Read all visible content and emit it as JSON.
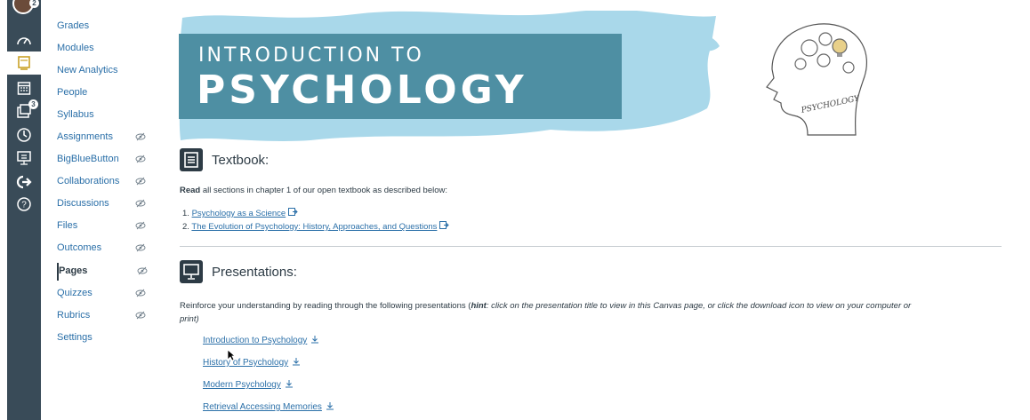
{
  "course_nav": {
    "items": [
      {
        "label": "Grades",
        "hidden": false
      },
      {
        "label": "Modules",
        "hidden": false
      },
      {
        "label": "New Analytics",
        "hidden": false
      },
      {
        "label": "People",
        "hidden": false
      },
      {
        "label": "Syllabus",
        "hidden": false
      },
      {
        "label": "Assignments",
        "hidden": true
      },
      {
        "label": "BigBlueButton",
        "hidden": true
      },
      {
        "label": "Collaborations",
        "hidden": true
      },
      {
        "label": "Discussions",
        "hidden": true
      },
      {
        "label": "Files",
        "hidden": true
      },
      {
        "label": "Outcomes",
        "hidden": true
      },
      {
        "label": "Pages",
        "hidden": true,
        "current": true
      },
      {
        "label": "Quizzes",
        "hidden": true
      },
      {
        "label": "Rubrics",
        "hidden": true
      },
      {
        "label": "Settings",
        "hidden": false
      }
    ]
  },
  "global_nav": {
    "account_badge": "2",
    "inbox_badge": "3",
    "icons": [
      "account-icon",
      "dashboard-icon",
      "courses-icon",
      "calendar-icon",
      "inbox-icon",
      "history-icon",
      "studio-icon",
      "logout-icon",
      "help-icon"
    ]
  },
  "banner": {
    "line1": "INTRODUCTION TO",
    "line2": "PSYCHOLOGY",
    "head_label": "PSYCHOLOGY"
  },
  "textbook": {
    "title": "Textbook:",
    "intro_bold": "Read",
    "intro_rest": " all sections in chapter 1 of our open textbook as described below:",
    "items": [
      {
        "num": "1.",
        "label": "Psychology as a Science"
      },
      {
        "num": "2.",
        "label": "The Evolution of Psychology: History, Approaches, and Questions"
      }
    ]
  },
  "presentations": {
    "title": "Presentations:",
    "intro_a": "Reinforce your understanding by reading through the following presentations (",
    "intro_hint": "hint",
    "intro_b": ": click on the presentation title to view in this Canvas page, or click the download icon to view on your computer or",
    "intro_c": "print)",
    "links": [
      "Introduction to Psychology",
      "History of Psychology",
      "Modern Psychology",
      "Retrieval Accessing Memories"
    ]
  },
  "colors": {
    "nav_bg": "#394b58",
    "link": "#2a6fa8",
    "banner_teal": "#4e8fa3",
    "banner_wash": "#a9d8ea"
  }
}
